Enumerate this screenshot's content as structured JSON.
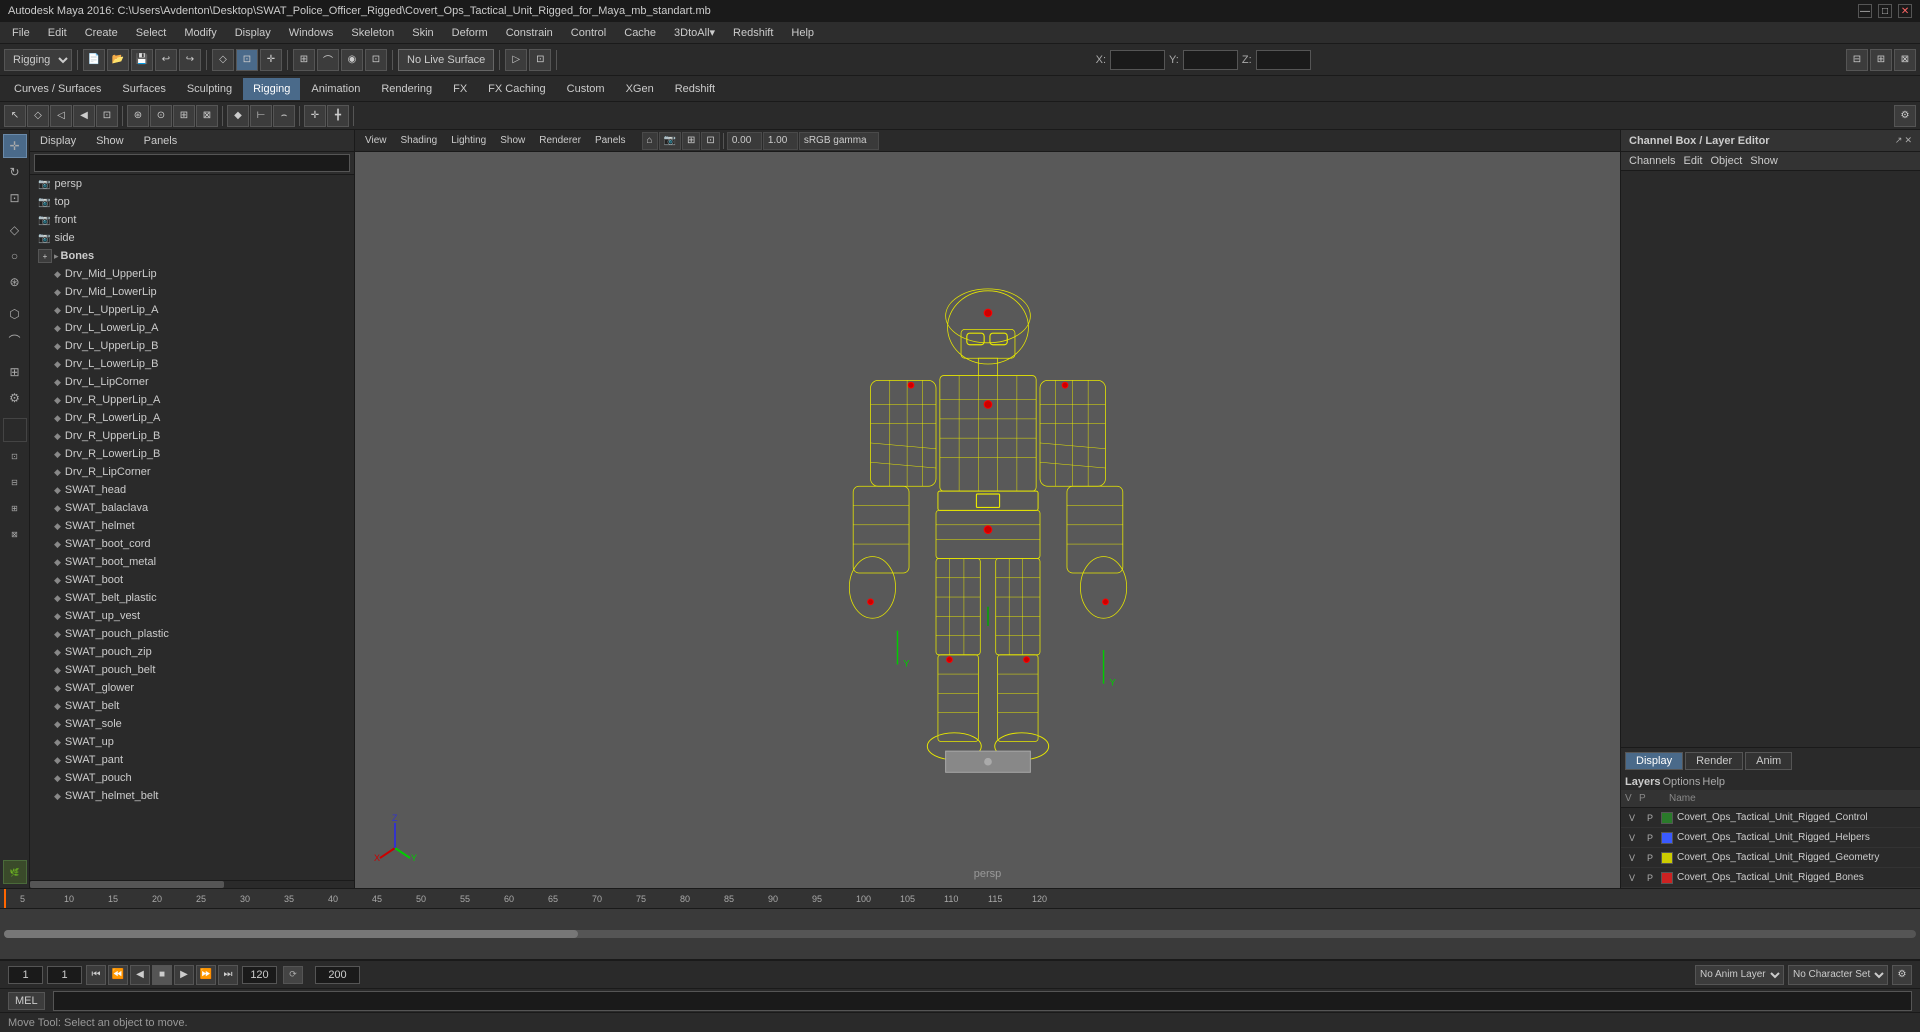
{
  "titlebar": {
    "title": "Autodesk Maya 2016: C:\\Users\\Avdenton\\Desktop\\SWAT_Police_Officer_Rigged\\Covert_Ops_Tactical_Unit_Rigged_for_Maya_mb_standart.mb",
    "minimize": "—",
    "maximize": "□",
    "close": "✕"
  },
  "menubar": {
    "items": [
      "File",
      "Edit",
      "Create",
      "Select",
      "Modify",
      "Display",
      "Windows",
      "Skeleton",
      "Skin",
      "Deform",
      "Constrain",
      "Control",
      "Cache",
      "3DtoAll▾",
      "Redshift",
      "Help"
    ]
  },
  "toolbar": {
    "mode_select": "Rigging",
    "no_live_surface": "No Live Surface",
    "xyz_label_x": "X:",
    "xyz_label_y": "Y:",
    "xyz_label_z": "Z:"
  },
  "secondary_toolbar": {
    "tabs": [
      "Curves / Surfaces",
      "Surfaces",
      "Sculpting",
      "Rigging",
      "Animation",
      "Rendering",
      "FX",
      "FX Caching",
      "Custom",
      "XGen",
      "Redshift"
    ]
  },
  "outliner": {
    "display_tabs": [
      "Display",
      "Show",
      "Panels"
    ],
    "search_placeholder": "",
    "nodes": [
      {
        "id": "persp",
        "label": "persp",
        "type": "camera",
        "depth": 0
      },
      {
        "id": "top",
        "label": "top",
        "type": "camera",
        "depth": 0
      },
      {
        "id": "front",
        "label": "front",
        "type": "camera",
        "depth": 0
      },
      {
        "id": "side",
        "label": "side",
        "type": "camera",
        "depth": 0
      },
      {
        "id": "bones",
        "label": "Bones",
        "type": "group",
        "depth": 0,
        "expanded": true
      },
      {
        "id": "drv_mid_upperlip",
        "label": "Drv_Mid_UpperLip",
        "type": "bone",
        "depth": 1
      },
      {
        "id": "drv_mid_lowerlip",
        "label": "Drv_Mid_LowerLip",
        "type": "bone",
        "depth": 1
      },
      {
        "id": "drv_l_upperlip_a",
        "label": "Drv_L_UpperLip_A",
        "type": "bone",
        "depth": 1
      },
      {
        "id": "drv_l_lowerlip_a",
        "label": "Drv_L_LowerLip_A",
        "type": "bone",
        "depth": 1
      },
      {
        "id": "drv_l_upperlip_b",
        "label": "Drv_L_UpperLip_B",
        "type": "bone",
        "depth": 1
      },
      {
        "id": "drv_l_lowerlip_b",
        "label": "Drv_L_LowerLip_B",
        "type": "bone",
        "depth": 1
      },
      {
        "id": "drv_l_lipcorner",
        "label": "Drv_L_LipCorner",
        "type": "bone",
        "depth": 1
      },
      {
        "id": "drv_r_upperlip_a",
        "label": "Drv_R_UpperLip_A",
        "type": "bone",
        "depth": 1
      },
      {
        "id": "drv_r_lowerlip_a",
        "label": "Drv_R_LowerLip_A",
        "type": "bone",
        "depth": 1
      },
      {
        "id": "drv_r_upperlip_b",
        "label": "Drv_R_UpperLip_B",
        "type": "bone",
        "depth": 1
      },
      {
        "id": "drv_r_lowerlip_b",
        "label": "Drv_R_LowerLip_B",
        "type": "bone",
        "depth": 1
      },
      {
        "id": "drv_r_lipcorner",
        "label": "Drv_R_LipCorner",
        "type": "bone",
        "depth": 1
      },
      {
        "id": "swat_head",
        "label": "SWAT_head",
        "type": "mesh",
        "depth": 1
      },
      {
        "id": "swat_balaclava",
        "label": "SWAT_balaclava",
        "type": "mesh",
        "depth": 1
      },
      {
        "id": "swat_helmet",
        "label": "SWAT_helmet",
        "type": "mesh",
        "depth": 1
      },
      {
        "id": "swat_boot_cord",
        "label": "SWAT_boot_cord",
        "type": "mesh",
        "depth": 1
      },
      {
        "id": "swat_boot_metal",
        "label": "SWAT_boot_metal",
        "type": "mesh",
        "depth": 1
      },
      {
        "id": "swat_boot",
        "label": "SWAT_boot",
        "type": "mesh",
        "depth": 1
      },
      {
        "id": "swat_belt_plastic",
        "label": "SWAT_belt_plastic",
        "type": "mesh",
        "depth": 1
      },
      {
        "id": "swat_up_vest",
        "label": "SWAT_up_vest",
        "type": "mesh",
        "depth": 1
      },
      {
        "id": "swat_pouch_plastic",
        "label": "SWAT_pouch_plastic",
        "type": "mesh",
        "depth": 1
      },
      {
        "id": "swat_pouch_zip",
        "label": "SWAT_pouch_zip",
        "type": "mesh",
        "depth": 1
      },
      {
        "id": "swat_pouch_belt",
        "label": "SWAT_pouch_belt",
        "type": "mesh",
        "depth": 1
      },
      {
        "id": "swat_glower",
        "label": "SWAT_glower",
        "type": "mesh",
        "depth": 1
      },
      {
        "id": "swat_belt",
        "label": "SWAT_belt",
        "type": "mesh",
        "depth": 1
      },
      {
        "id": "swat_sole",
        "label": "SWAT_sole",
        "type": "mesh",
        "depth": 1
      },
      {
        "id": "swat_up",
        "label": "SWAT_up",
        "type": "mesh",
        "depth": 1
      },
      {
        "id": "swat_pant",
        "label": "SWAT_pant",
        "type": "mesh",
        "depth": 1
      },
      {
        "id": "swat_pouch",
        "label": "SWAT_pouch",
        "type": "mesh",
        "depth": 1
      },
      {
        "id": "swat_helmet_belt",
        "label": "SWAT_helmet_belt",
        "type": "mesh",
        "depth": 1
      }
    ]
  },
  "viewport": {
    "menu_items": [
      "View",
      "Shading",
      "Lighting",
      "Show",
      "Renderer",
      "Panels"
    ],
    "label": "persp",
    "gamma": "sRGB gamma",
    "near_clip": "0.00",
    "far_clip": "1.00"
  },
  "channel_box": {
    "title": "Channel Box / Layer Editor",
    "tabs": [
      "Channels",
      "Edit",
      "Object",
      "Show"
    ],
    "bottom_tabs": [
      {
        "label": "Display",
        "active": true
      },
      {
        "label": "Render",
        "active": false
      },
      {
        "label": "Anim",
        "active": false
      }
    ],
    "sub_tabs": [
      "Layers",
      "Options",
      "Help"
    ],
    "layers": [
      {
        "v": "V",
        "p": "P",
        "color": "#2a7a2a",
        "name": "Covert_Ops_Tactical_Unit_Rigged_Control"
      },
      {
        "v": "V",
        "p": "P",
        "color": "#3a5aff",
        "name": "Covert_Ops_Tactical_Unit_Rigged_Helpers"
      },
      {
        "v": "V",
        "p": "P",
        "color": "#cccc00",
        "name": "Covert_Ops_Tactical_Unit_Rigged_Geometry"
      },
      {
        "v": "V",
        "p": "P",
        "color": "#cc2222",
        "name": "Covert_Ops_Tactical_Unit_Rigged_Bones"
      }
    ]
  },
  "timeline": {
    "start_frame": "1",
    "end_frame": "120",
    "current_frame": "1",
    "range_start": "1",
    "range_end": "120",
    "max_frame": "200",
    "anim_layer": "No Anim Layer",
    "character_set": "No Character Set",
    "ruler_marks": [
      "5",
      "10",
      "15",
      "20",
      "25",
      "30",
      "35",
      "40",
      "45",
      "50",
      "55",
      "60",
      "65",
      "70",
      "75",
      "80",
      "85",
      "90",
      "95",
      "100",
      "105",
      "110",
      "115",
      "120"
    ]
  },
  "status_bar": {
    "text": "Move Tool: Select an object to move.",
    "mel_label": "MEL"
  },
  "icons": {
    "arrow": "↖",
    "select": "◇",
    "lasso": "○",
    "move": "✛",
    "rotate": "↻",
    "scale": "⊡",
    "camera": "📷",
    "bone": "◆",
    "expand": "▸",
    "collapse": "▾",
    "play": "▶",
    "play_back": "◀",
    "skip_start": "⏮",
    "skip_end": "⏭",
    "step_back": "⏪",
    "step_fwd": "⏩"
  }
}
